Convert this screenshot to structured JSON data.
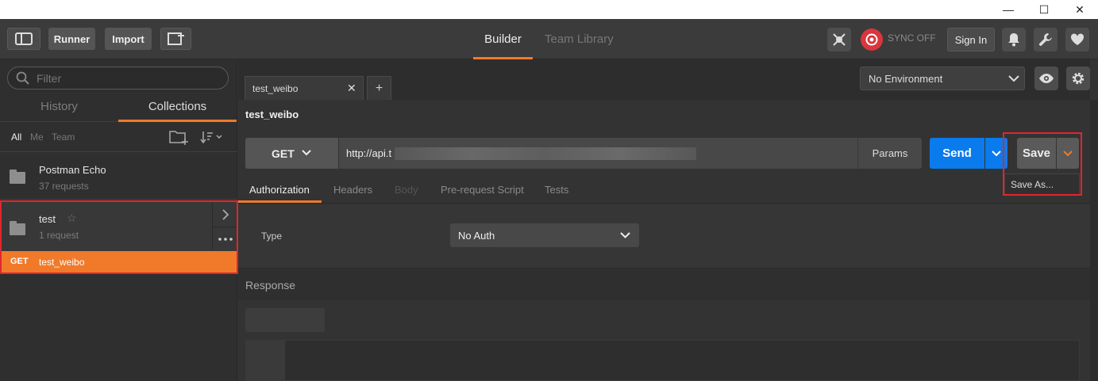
{
  "window_controls": {
    "minimize": "—",
    "maximize": "☐",
    "close": "✕"
  },
  "toolbar": {
    "runner": "Runner",
    "import": "Import",
    "tabs": [
      {
        "label": "Builder",
        "active": true
      },
      {
        "label": "Team Library",
        "active": false
      }
    ],
    "sync_status": "SYNC OFF",
    "sign_in": "Sign In"
  },
  "sidebar": {
    "filter_placeholder": "Filter",
    "tabs": [
      {
        "label": "History",
        "active": false
      },
      {
        "label": "Collections",
        "active": true
      }
    ],
    "subfilters": [
      "All",
      "Me",
      "Team"
    ],
    "collections": [
      {
        "name": "Postman Echo",
        "count": "37 requests"
      },
      {
        "name": "test",
        "count": "1 request"
      }
    ],
    "request": {
      "method": "GET",
      "name": "test_weibo"
    }
  },
  "main": {
    "open_tab": "test_weibo",
    "environment": "No Environment",
    "request_title": "test_weibo",
    "method": "GET",
    "url": "http://api.t",
    "params": "Params",
    "send": "Send",
    "save": "Save",
    "save_as": "Save As...",
    "subtabs": [
      {
        "label": "Authorization",
        "active": true,
        "disabled": false
      },
      {
        "label": "Headers",
        "active": false,
        "disabled": false
      },
      {
        "label": "Body",
        "active": false,
        "disabled": true
      },
      {
        "label": "Pre-request Script",
        "active": false,
        "disabled": false
      },
      {
        "label": "Tests",
        "active": false,
        "disabled": false
      }
    ],
    "auth_type_label": "Type",
    "auth_type_value": "No Auth",
    "response_label": "Response"
  },
  "colors": {
    "accent": "#f07a2a",
    "send_blue": "#097bed",
    "highlight_red": "#e0262f"
  }
}
